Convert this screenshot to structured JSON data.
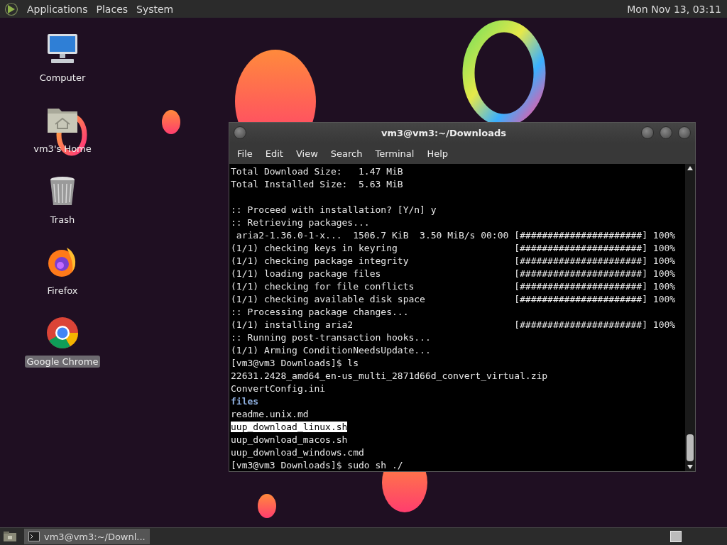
{
  "top_panel": {
    "menus": [
      "Applications",
      "Places",
      "System"
    ],
    "clock": "Mon Nov 13, 03:11"
  },
  "desktop_icons": [
    {
      "kind": "computer",
      "label": "Computer",
      "selected": false
    },
    {
      "kind": "home",
      "label": "vm3's Home",
      "selected": false
    },
    {
      "kind": "trash",
      "label": "Trash",
      "selected": false
    },
    {
      "kind": "firefox",
      "label": "Firefox",
      "selected": false
    },
    {
      "kind": "chrome",
      "label": "Google Chrome",
      "selected": true
    }
  ],
  "terminal": {
    "title": "vm3@vm3:~/Downloads",
    "menu": [
      "File",
      "Edit",
      "View",
      "Search",
      "Terminal",
      "Help"
    ],
    "lines": [
      {
        "kind": "text",
        "text": "Total Download Size:   1.47 MiB",
        "selected": false
      },
      {
        "kind": "text",
        "text": "Total Installed Size:  5.63 MiB",
        "selected": false
      },
      {
        "kind": "blank"
      },
      {
        "kind": "text",
        "text": ":: Proceed with installation? [Y/n] y",
        "selected": false
      },
      {
        "kind": "text",
        "text": ":: Retrieving packages...",
        "selected": false
      },
      {
        "kind": "text",
        "text": " aria2-1.36.0-1-x...  1506.7 KiB  3.50 MiB/s 00:00 [######################] 100%",
        "selected": false
      },
      {
        "kind": "text",
        "text": "(1/1) checking keys in keyring                     [######################] 100%",
        "selected": false
      },
      {
        "kind": "text",
        "text": "(1/1) checking package integrity                   [######################] 100%",
        "selected": false
      },
      {
        "kind": "text",
        "text": "(1/1) loading package files                        [######################] 100%",
        "selected": false
      },
      {
        "kind": "text",
        "text": "(1/1) checking for file conflicts                  [######################] 100%",
        "selected": false
      },
      {
        "kind": "text",
        "text": "(1/1) checking available disk space                [######################] 100%",
        "selected": false
      },
      {
        "kind": "text",
        "text": ":: Processing package changes...",
        "selected": false
      },
      {
        "kind": "text",
        "text": "(1/1) installing aria2                             [######################] 100%",
        "selected": false
      },
      {
        "kind": "text",
        "text": ":: Running post-transaction hooks...",
        "selected": false
      },
      {
        "kind": "text",
        "text": "(1/1) Arming ConditionNeedsUpdate...",
        "selected": false
      },
      {
        "kind": "text",
        "text": "[vm3@vm3 Downloads]$ ls",
        "selected": false
      },
      {
        "kind": "text",
        "text": "22631.2428_amd64_en-us_multi_2871d66d_convert_virtual.zip",
        "selected": false
      },
      {
        "kind": "text",
        "text": "ConvertConfig.ini",
        "selected": false
      },
      {
        "kind": "directory",
        "text": "files",
        "selected": false
      },
      {
        "kind": "text",
        "text": "readme.unix.md",
        "selected": false
      },
      {
        "kind": "text",
        "text": "uup_download_linux.sh",
        "selected": true
      },
      {
        "kind": "text",
        "text": "uup_download_macos.sh",
        "selected": false
      },
      {
        "kind": "text",
        "text": "uup_download_windows.cmd",
        "selected": false
      },
      {
        "kind": "text",
        "text": "[vm3@vm3 Downloads]$ sudo sh ./",
        "selected": false
      }
    ]
  },
  "taskbar": {
    "tasks": [
      {
        "label": "vm3@vm3:~/Downl...",
        "selected": true
      }
    ]
  }
}
